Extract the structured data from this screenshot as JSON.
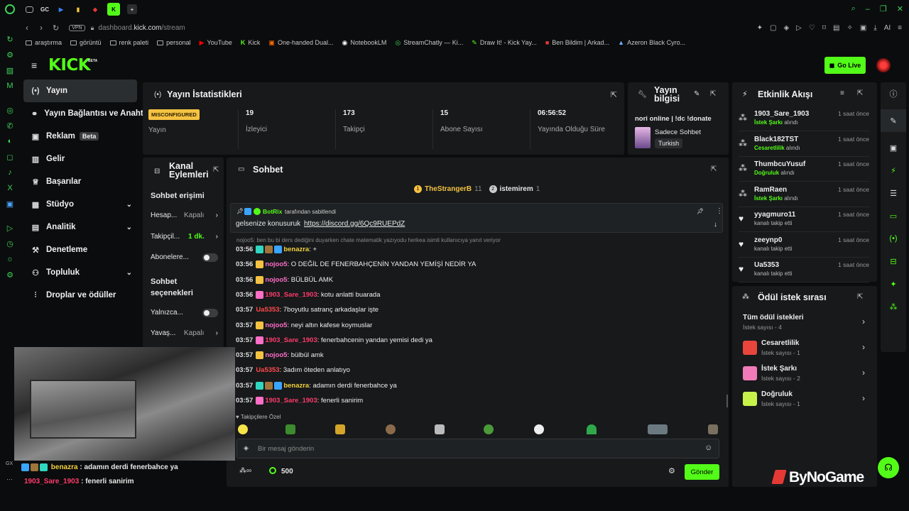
{
  "browser": {
    "tabs": [
      "GC"
    ],
    "url_prefix": "dashboard.",
    "url_domain": "kick.com",
    "url_path": "/stream",
    "vpn_label": "VPN",
    "ai_label": "AI",
    "bookmarks": [
      "araştırma",
      "görüntü",
      "renk paleti",
      "personal",
      "YouTube",
      "Kick",
      "One-handed Dual...",
      "NotebookLM",
      "StreamChatly — Ki...",
      "Draw It! - Kick Yay...",
      "Ben Bildim | Arkad...",
      "Azeron Black Cyro..."
    ]
  },
  "header": {
    "logo": "KICK",
    "logo_badge": "BETA",
    "go_live": "Go Live"
  },
  "nav": [
    {
      "label": "Yayın",
      "icon": "stream-icon",
      "active": true
    },
    {
      "label": "Yayın Bağlantısı ve Anahtarı",
      "icon": "link-icon"
    },
    {
      "label": "Reklam",
      "icon": "ads-icon",
      "badge": "Beta"
    },
    {
      "label": "Gelir",
      "icon": "revenue-icon"
    },
    {
      "label": "Başarılar",
      "icon": "trophy-icon"
    },
    {
      "label": "Stüdyo",
      "icon": "studio-icon",
      "chevron": true
    },
    {
      "label": "Analitik",
      "icon": "analytics-icon",
      "chevron": true
    },
    {
      "label": "Denetleme",
      "icon": "hammer-icon"
    },
    {
      "label": "Topluluk",
      "icon": "community-icon",
      "chevron": true
    },
    {
      "label": "Droplar ve ödüller",
      "icon": "drops-icon"
    }
  ],
  "stats": {
    "title": "Yayın İstatistikleri",
    "status_badge": "MISCONFIGURED",
    "status_label": "Yayın",
    "items": [
      {
        "value": "19",
        "label": "İzleyici"
      },
      {
        "value": "173",
        "label": "Takipçi"
      },
      {
        "value": "15",
        "label": "Abone Sayısı"
      },
      {
        "value": "06:56:52",
        "label": "Yayında Olduğu Süre"
      }
    ]
  },
  "stream_info": {
    "title": "Yayın bilgisi",
    "stream_title": "nori online | !dc !donate",
    "category": "Sadece Sohbet",
    "language": "Turkish"
  },
  "channel_actions": {
    "title": "Kanal Eylemleri",
    "chat_access_title": "Sohbet erişimi",
    "rows": [
      {
        "label": "Hesap...",
        "value": "Kapalı"
      },
      {
        "label": "Takipçil...",
        "value": "1 dk."
      },
      {
        "label": "Abonelere..."
      }
    ],
    "chat_options_title": "Sohbet seçenekleri",
    "rows2": [
      {
        "label": "Yalnızca..."
      },
      {
        "label": "Yavaş...",
        "value": "Kapalı"
      }
    ]
  },
  "chat": {
    "title": "Sohbet",
    "top_users": [
      {
        "rank": "1",
        "name": "TheStrangerB",
        "count": "11"
      },
      {
        "rank": "2",
        "name": "istemirem",
        "count": "1"
      }
    ],
    "pinned_by": "BotRix",
    "pinned_by_suffix": "tarafından sabitlendi",
    "pinned_text": "gelsenize konusuruk",
    "pinned_link": "https://discord.gg/6Qc9RUEPdZ",
    "reply_hint": "nojoo5: ben bu bi ders dediğini duyarken chate matematik yazıyodu herkea isimli kullanıcıya yanıt veriyor",
    "messages": [
      {
        "time": "03:56",
        "user": "benazra",
        "color": "#f3d23b",
        "text": ": +"
      },
      {
        "time": "03:56",
        "user": "nojoo5",
        "color": "#ff6ec7",
        "text": ": O DEĞİL DE FENERBAHÇENİN YANDAN YEMİŞİ NEDİR YA"
      },
      {
        "time": "03:56",
        "user": "nojoo5",
        "color": "#ff6ec7",
        "text": ": BÜLBÜL AMK"
      },
      {
        "time": "03:56",
        "user": "1903_Sare_1903",
        "color": "#ff3b6b",
        "text": ": kotu anlatti buarada"
      },
      {
        "time": "03:57",
        "user": "Ua5353",
        "color": "#ff4a4a",
        "text": ": 7boyutlu satranç arkadaşlar işte"
      },
      {
        "time": "03:57",
        "user": "nojoo5",
        "color": "#ff6ec7",
        "text": ": neyi altın kafese koymuslar"
      },
      {
        "time": "03:57",
        "user": "1903_Sare_1903",
        "color": "#ff3b6b",
        "text": ": fenerbahcenin yandan yemisi dedi ya"
      },
      {
        "time": "03:57",
        "user": "nojoo5",
        "color": "#ff6ec7",
        "text": ": bülbül amk"
      },
      {
        "time": "03:57",
        "user": "Ua5353",
        "color": "#ff4a4a",
        "text": ": 3adım öteden anlatıyo"
      },
      {
        "time": "03:57",
        "user": "benazra",
        "color": "#f3d23b",
        "text": ": adamın derdi fenerbahce ya"
      },
      {
        "time": "03:57",
        "user": "1903_Sare_1903",
        "color": "#ff3b6b",
        "text": ": fenerli sanirim"
      }
    ],
    "emote_label": "Takipçilere Özel",
    "input_placeholder": "Bir mesaj gönderin",
    "points": "500",
    "send": "Gönder"
  },
  "overlay": {
    "msg1_user": "benazra",
    "msg1_text": " : adamın derdi fenerbahce ya",
    "msg2_user": "1903_Sare_1903",
    "msg2_text": " : fenerli sanirim"
  },
  "activity": {
    "title": "Etkinlik Akışı",
    "items": [
      {
        "name": "1903_Sare_1903",
        "action": "İstek Şarkı",
        "suffix": " alındı",
        "time": "1 saat önce",
        "icon": "redeem-icon"
      },
      {
        "name": "Black182TST",
        "action": "Cesaretlilik",
        "suffix": " alındı",
        "time": "1 saat önce",
        "icon": "redeem-icon"
      },
      {
        "name": "ThumbcuYusuf",
        "action": "Doğruluk",
        "suffix": " alındı",
        "time": "1 saat önce",
        "icon": "redeem-icon"
      },
      {
        "name": "RamRaen",
        "action": "İstek Şarkı",
        "suffix": " alındı",
        "time": "1 saat önce",
        "icon": "redeem-icon"
      },
      {
        "name": "yyagmuro11",
        "action": "",
        "suffix": "kanalı takip etti",
        "time": "1 saat önce",
        "icon": "heart-icon"
      },
      {
        "name": "zeeynp0",
        "action": "",
        "suffix": "kanalı takip etti",
        "time": "1 saat önce",
        "icon": "heart-icon"
      },
      {
        "name": "Ua5353",
        "action": "",
        "suffix": "kanalı takip etti",
        "time": "1 saat önce",
        "icon": "heart-icon"
      }
    ]
  },
  "rewards": {
    "title": "Ödül istek sırası",
    "items": [
      {
        "name": "Tüm ödül istekleri",
        "sub": "İstek sayısı - 4",
        "color": ""
      },
      {
        "name": "Cesaretlilik",
        "sub": "İstek sayısı - 1",
        "color": "#e8453c"
      },
      {
        "name": "İstek Şarkı",
        "sub": "İstek sayısı - 2",
        "color": "#f07bb8"
      },
      {
        "name": "Doğruluk",
        "sub": "İstek sayısı - 1",
        "color": "#c6f24a"
      }
    ]
  },
  "watermark": "ByNoGame",
  "colors": {
    "accent": "#53fc18",
    "panel": "#17191b",
    "bg": "#0b0c0d"
  }
}
